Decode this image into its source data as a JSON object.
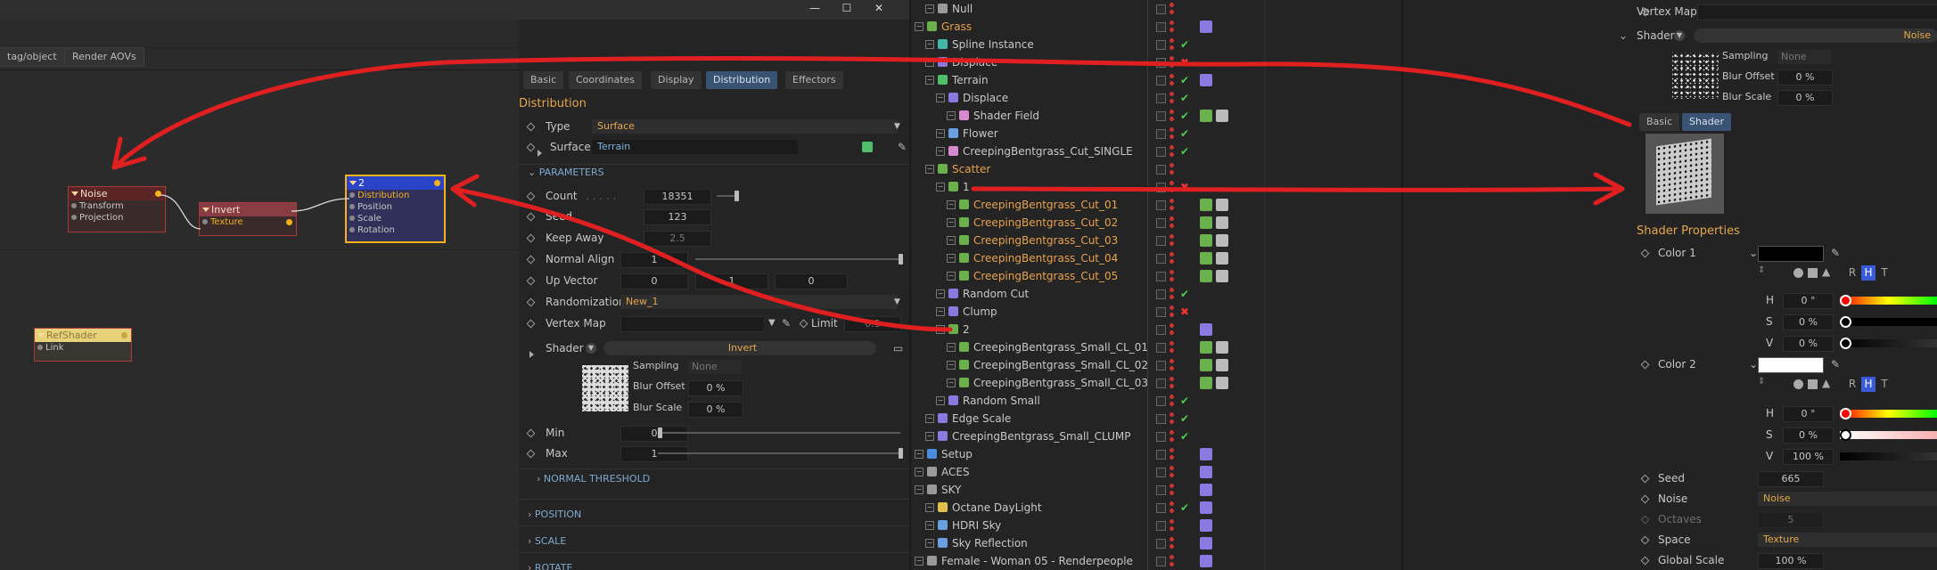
{
  "window": {
    "minimize": "—",
    "maximize": "☐",
    "close": "✕"
  },
  "node_editor": {
    "breadcrumb": "tag/object",
    "render_aovs": "Render AOVs",
    "nodes": {
      "noise": {
        "title": "Noise",
        "ports": [
          "Transform",
          "Projection"
        ]
      },
      "invert": {
        "title": "Invert",
        "ports": [
          "Texture"
        ]
      },
      "distribution": {
        "title": "2",
        "ports": [
          "Distribution",
          "Position",
          "Scale",
          "Rotation"
        ]
      },
      "refshader": {
        "title": "RefShader",
        "ports": [
          "Link"
        ]
      }
    }
  },
  "attributes": {
    "tabs": [
      "Basic",
      "Coordinates",
      "Display",
      "Distribution",
      "Effectors"
    ],
    "active_tab": "Distribution",
    "section_title": "Distribution",
    "type_label": "Type",
    "type_value": "Surface",
    "surface_label": "Surface",
    "surface_value": "Terrain",
    "parameters_header": "PARAMETERS",
    "count_label": "Count",
    "count_value": "18351",
    "seed_label": "Seed",
    "seed_value": "123",
    "keepaway_label": "Keep Away",
    "keepaway_value": "2.5",
    "normal_label": "Normal Align",
    "normal_value": "1",
    "upvector_label": "Up Vector",
    "upvector_x": "0",
    "upvector_y": "1",
    "upvector_z": "0",
    "random_label": "Randomization",
    "random_value": "New_1",
    "vertexmap_label": "Vertex Map",
    "limit_label": "Limit",
    "limit_value": "0.5",
    "shader_label": "Shader",
    "shader_value": "Invert",
    "sampling_label": "Sampling",
    "sampling_value": "None",
    "bluroffset_label": "Blur Offset",
    "bluroffset_value": "0 %",
    "blurscale_label": "Blur Scale",
    "blurscale_value": "0 %",
    "min_label": "Min",
    "min_value": "0",
    "max_label": "Max",
    "max_value": "1",
    "normal_threshold": "NORMAL THRESHOLD",
    "position": "POSITION",
    "scale": "SCALE",
    "rotate": "ROTATE"
  },
  "objects": [
    {
      "name": "Null",
      "indent": 1,
      "status": "none",
      "color": "#9a9a9a",
      "orange": false
    },
    {
      "name": "Grass",
      "indent": 0,
      "status": "none",
      "color": "#6ab04c",
      "orange": true
    },
    {
      "name": "Spline Instance",
      "indent": 1,
      "status": "check",
      "color": "#46b6a8",
      "orange": false
    },
    {
      "name": "Displace",
      "indent": 1,
      "status": "cross",
      "color": "#8a7adf",
      "orange": false
    },
    {
      "name": "Terrain",
      "indent": 1,
      "status": "check",
      "color": "#4fbf6a",
      "orange": false
    },
    {
      "name": "Displace",
      "indent": 2,
      "status": "check",
      "color": "#8a7adf",
      "orange": false
    },
    {
      "name": "Shader Field",
      "indent": 3,
      "status": "check",
      "color": "#d58ad1",
      "orange": false
    },
    {
      "name": "Flower",
      "indent": 2,
      "status": "check",
      "color": "#6aa0df",
      "orange": false
    },
    {
      "name": "CreepingBentgrass_Cut_SINGLE",
      "indent": 2,
      "status": "check",
      "color": "#d58ad1",
      "orange": false
    },
    {
      "name": "Scatter",
      "indent": 1,
      "status": "none",
      "color": "#6ab04c",
      "orange": true
    },
    {
      "name": "1",
      "indent": 2,
      "status": "cross",
      "color": "#6ab04c",
      "orange": false
    },
    {
      "name": "CreepingBentgrass_Cut_01",
      "indent": 3,
      "status": "none",
      "color": "#6ab04c",
      "orange": true
    },
    {
      "name": "CreepingBentgrass_Cut_02",
      "indent": 3,
      "status": "none",
      "color": "#6ab04c",
      "orange": true
    },
    {
      "name": "CreepingBentgrass_Cut_03",
      "indent": 3,
      "status": "none",
      "color": "#6ab04c",
      "orange": true
    },
    {
      "name": "CreepingBentgrass_Cut_04",
      "indent": 3,
      "status": "none",
      "color": "#6ab04c",
      "orange": true
    },
    {
      "name": "CreepingBentgrass_Cut_05",
      "indent": 3,
      "status": "none",
      "color": "#6ab04c",
      "orange": true
    },
    {
      "name": "Random Cut",
      "indent": 2,
      "status": "check",
      "color": "#8a7adf",
      "orange": false
    },
    {
      "name": "Clump",
      "indent": 2,
      "status": "cross",
      "color": "#8a7adf",
      "orange": false
    },
    {
      "name": "2",
      "indent": 2,
      "status": "none",
      "color": "#6ab04c",
      "orange": false
    },
    {
      "name": "CreepingBentgrass_Small_CL_01",
      "indent": 3,
      "status": "none",
      "color": "#6ab04c",
      "orange": false
    },
    {
      "name": "CreepingBentgrass_Small_CL_02",
      "indent": 3,
      "status": "none",
      "color": "#6ab04c",
      "orange": false
    },
    {
      "name": "CreepingBentgrass_Small_CL_03",
      "indent": 3,
      "status": "none",
      "color": "#6ab04c",
      "orange": false
    },
    {
      "name": "Random Small",
      "indent": 2,
      "status": "check",
      "color": "#8a7adf",
      "orange": false
    },
    {
      "name": "Edge Scale",
      "indent": 1,
      "status": "check",
      "color": "#8a7adf",
      "orange": false
    },
    {
      "name": "CreepingBentgrass_Small_CLUMP",
      "indent": 1,
      "status": "check",
      "color": "#8a7adf",
      "orange": false
    },
    {
      "name": "Setup",
      "indent": 0,
      "status": "none",
      "color": "#4a8de0",
      "orange": false
    },
    {
      "name": "ACES",
      "indent": 0,
      "status": "none",
      "color": "#9a9a9a",
      "orange": false
    },
    {
      "name": "SKY",
      "indent": 0,
      "status": "none",
      "color": "#9a9a9a",
      "orange": false
    },
    {
      "name": "Octane DayLight",
      "indent": 1,
      "status": "check",
      "color": "#e0c04a",
      "orange": false
    },
    {
      "name": "HDRI Sky",
      "indent": 1,
      "status": "none",
      "color": "#6aa0df",
      "orange": false
    },
    {
      "name": "Sky Reflection",
      "indent": 1,
      "status": "none",
      "color": "#6aa0df",
      "orange": false
    },
    {
      "name": "Female - Woman 05 - Renderpeople",
      "indent": 0,
      "status": "none",
      "color": "#9a9a9a",
      "orange": false
    }
  ],
  "right_panel": {
    "vertexmap_label": "Vertex Map",
    "shader_label": "Shader",
    "shader_value": "Noise",
    "sampling_label": "Sampling",
    "sampling_value": "None",
    "bluroffset_label": "Blur Offset",
    "bluroffset_value": "0 %",
    "blurscale_label": "Blur Scale",
    "blurscale_value": "0 %",
    "tabs": [
      "Basic",
      "Shader"
    ],
    "active_tab": "Shader",
    "shader_props": "Shader Properties",
    "color1_label": "Color 1",
    "color2_label": "Color 2",
    "rht": [
      "R",
      "H",
      "T"
    ],
    "h_label": "H",
    "s_label": "S",
    "v_label": "V",
    "c1_h": "0 °",
    "c1_s": "0 %",
    "c1_v": "0 %",
    "c2_h": "0 °",
    "c2_s": "0 %",
    "c2_v": "100 %",
    "seed_label": "Seed",
    "seed_value": "665",
    "noise_label": "Noise",
    "noise_value": "Noise",
    "octaves_label": "Octaves",
    "octaves_value": "5",
    "space_label": "Space",
    "space_value": "Texture",
    "globalscale_label": "Global Scale",
    "globalscale_value": "100 %"
  },
  "colors": {
    "accent": "#3a5373",
    "annotation_red": "#e02020",
    "node_header_selected": "#2a44c8"
  }
}
